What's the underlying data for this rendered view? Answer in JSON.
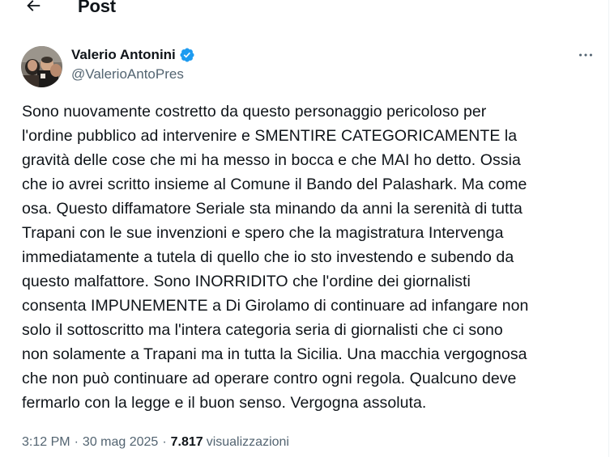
{
  "header": {
    "title": "Post",
    "back_icon": "arrow-left-icon"
  },
  "author": {
    "display_name": "Valerio Antonini",
    "handle": "@ValerioAntoPres",
    "verified": true,
    "verified_color": "#1d9bf0"
  },
  "tweet": {
    "text": "Sono nuovamente costretto da questo personaggio pericoloso per\nl'ordine pubblico ad intervenire e SMENTIRE CATEGORICAMENTE la\ngravità delle cose che mi ha messo in bocca e che MAI ho detto. Ossia\nche io avrei scritto insieme al Comune il Bando del Palashark. Ma come\nosa. Questo diffamatore Seriale sta minando da anni la serenità di tutta\nTrapani con le sue invenzioni e spero che la magistratura Intervenga\nimmediatamente a tutela di quello che io sto investendo e subendo da\nquesto malfattore. Sono INORRIDITO che l'ordine dei giornalisti\nconsenta IMPUNEMENTE a Di Girolamo di continuare ad infangare non\nsolo il sottoscritto ma l'intera categoria seria di giornalisti che ci sono\nnon solamente a Trapani ma in tutta la Sicilia. Una macchia vergognosa\nche non può continuare ad operare contro ogni regola. Qualcuno deve\nfermarlo con la legge e il buon senso. Vergogna assoluta."
  },
  "meta": {
    "time": "3:12 PM",
    "separator": "·",
    "date": "30 mag 2025",
    "views_count": "7.817",
    "views_label": "visualizzazioni"
  },
  "colors": {
    "text_primary": "#0f1419",
    "text_secondary": "#536471",
    "accent": "#1d9bf0"
  }
}
